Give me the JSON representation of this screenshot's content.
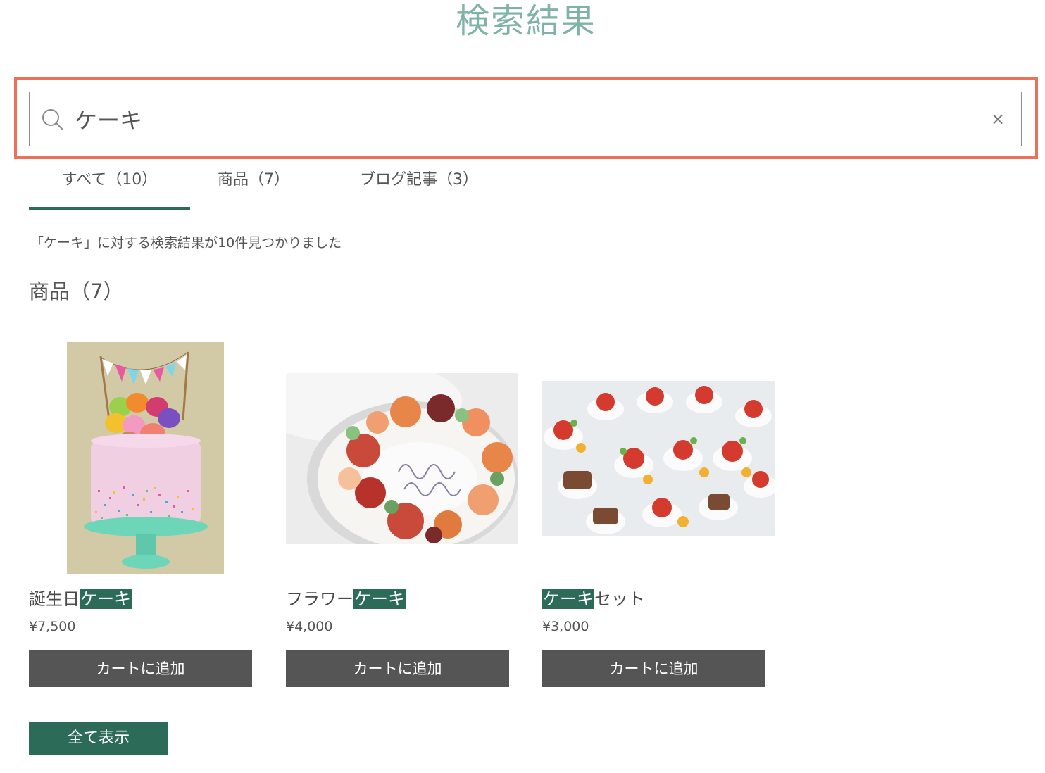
{
  "page": {
    "title": "検索結果"
  },
  "search": {
    "value": "ケーキ",
    "clear_label": "×"
  },
  "tabs": [
    {
      "label": "すべて（10）",
      "active": true
    },
    {
      "label": "商品（7）",
      "active": false
    },
    {
      "label": "ブログ記事（3）",
      "active": false
    }
  ],
  "results_summary": "「ケーキ」に対する検索結果が10件見つかりました",
  "products_section": {
    "heading": "商品（7）",
    "items": [
      {
        "name_prefix": "誕生日",
        "name_highlight": "ケーキ",
        "name_suffix": "",
        "price": "¥7,500",
        "button_label": "カートに追加"
      },
      {
        "name_prefix": "フラワー",
        "name_highlight": "ケーキ",
        "name_suffix": "",
        "price": "¥4,000",
        "button_label": "カートに追加"
      },
      {
        "name_prefix": "",
        "name_highlight": "ケーキ",
        "name_suffix": "セット",
        "price": "¥3,000",
        "button_label": "カートに追加"
      }
    ],
    "show_all_label": "全て表示"
  },
  "colors": {
    "title": "#7fb3a6",
    "accent": "#2c6b57",
    "highlight_frame": "#ec7158",
    "button": "#555555"
  }
}
